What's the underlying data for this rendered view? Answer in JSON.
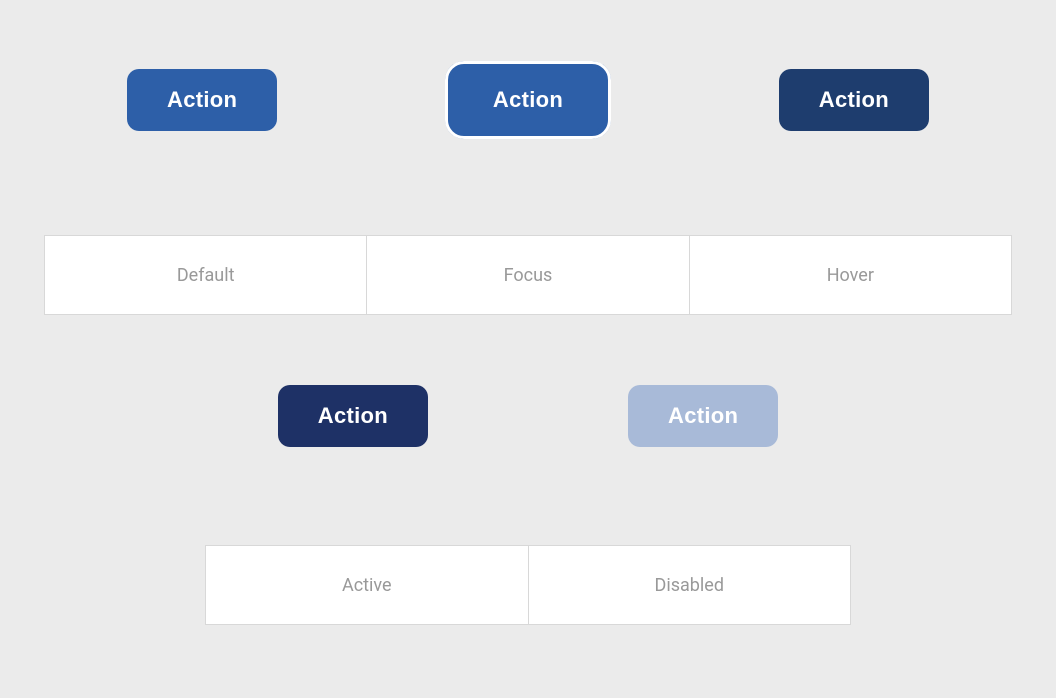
{
  "buttons": {
    "default_label": "Action",
    "focus_label": "Action",
    "hover_label": "Action",
    "active_label": "Action",
    "disabled_label": "Action"
  },
  "state_labels": {
    "default": "Default",
    "focus": "Focus",
    "hover": "Hover",
    "active": "Active",
    "disabled": "Disabled"
  },
  "colors": {
    "default_bg": "#2d5fa8",
    "focus_bg": "#2d5fa8",
    "hover_bg": "#1e3d6e",
    "active_bg": "#1e3166",
    "disabled_bg": "#a8bad8",
    "page_bg": "#ebebeb",
    "white": "#ffffff",
    "label_text": "#999999"
  }
}
